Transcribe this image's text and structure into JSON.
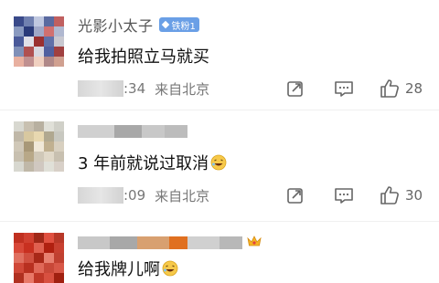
{
  "comments": [
    {
      "username": "光影小太子",
      "badge": "铁粉1",
      "text": "给我拍照立马就买",
      "time": ":34",
      "location": "来自北京",
      "likes": "28",
      "avatar_colors": [
        "#3a4a8a",
        "#7080b0",
        "#c0c8e0",
        "#5a6aa0",
        "#c06060",
        "#8a9ac0",
        "#2a3a7a",
        "#a0a8c8",
        "#d07070",
        "#b0b8d0",
        "#4a5a9a",
        "#e0e0e8",
        "#9a3030",
        "#6070a8",
        "#c8c8d0",
        "#8090b8",
        "#b05050",
        "#d8d8e0",
        "#5060a0",
        "#a04040",
        "#e8b0a0",
        "#c09090",
        "#f0d0c0",
        "#b08888",
        "#d0a090"
      ]
    },
    {
      "text": "3 年前就说过取消",
      "time": ":09",
      "location": "来自北京",
      "likes": "30",
      "avatar_colors": [
        "#d8d8d0",
        "#c8c0b0",
        "#b8b0a0",
        "#e0e0d8",
        "#d0d0c8",
        "#c0b8a8",
        "#d8c8a0",
        "#e8d8b0",
        "#b0a890",
        "#c8c8c0",
        "#d0c8b8",
        "#a89878",
        "#f0e8d8",
        "#c0b090",
        "#d8d0c0",
        "#c8c0b0",
        "#b8a888",
        "#d0c8b8",
        "#e0d8c8",
        "#c8c0b0",
        "#d8d8d0",
        "#c0b8a8",
        "#d0c8c0",
        "#e0e0d8",
        "#d8d0c8"
      ]
    },
    {
      "text": "给我牌儿啊",
      "avatar_colors": [
        "#c03020",
        "#d04030",
        "#a02818",
        "#e05040",
        "#b83828",
        "#d84838",
        "#c83020",
        "#e06050",
        "#b02010",
        "#c84030",
        "#e07060",
        "#d05040",
        "#a82818",
        "#e88070",
        "#c04030",
        "#d04838",
        "#b83020",
        "#e06858",
        "#c84838",
        "#d85848",
        "#b03020",
        "#e87868",
        "#c03828",
        "#d85040",
        "#a02010"
      ]
    }
  ],
  "actions": {
    "share_icon": "share-icon",
    "reply_icon": "comment-icon",
    "like_icon": "thumbs-up-icon"
  },
  "colors": {
    "badge_bg": "#6a9fe6",
    "meta_text": "#777777"
  }
}
